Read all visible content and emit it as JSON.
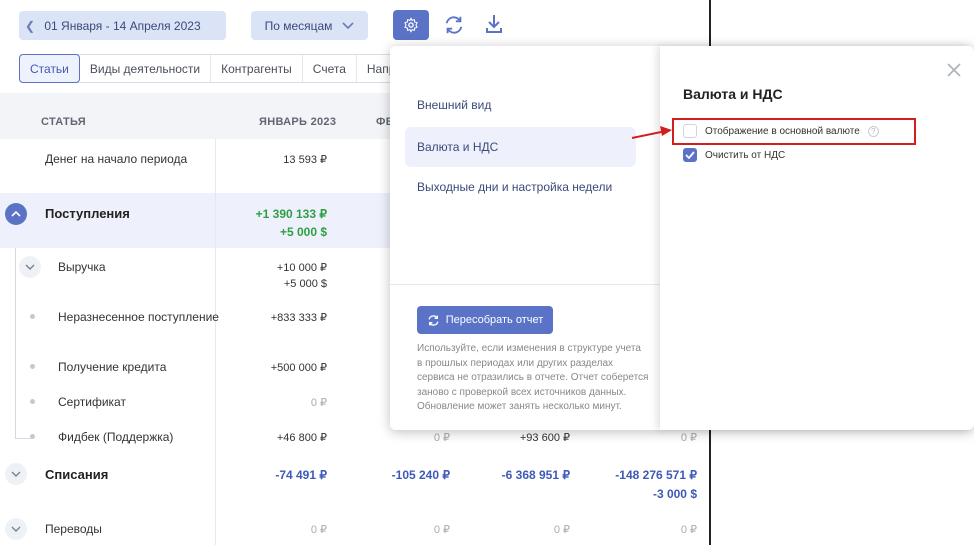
{
  "toolbar": {
    "date_range": "01 Января - 14 Апреля 2023",
    "period": "По месяцам"
  },
  "tabs": [
    "Статьи",
    "Виды деятельности",
    "Контрагенты",
    "Счета",
    "Напр"
  ],
  "table": {
    "headers": {
      "article": "СТАТЬЯ",
      "jan": "ЯНВАРЬ 2023",
      "feb": "ФЕ"
    },
    "rows": {
      "start": {
        "label": "Денег на начало периода",
        "jan": "13 593 ₽"
      },
      "income": {
        "label": "Поступления",
        "jan1": "+1 390 133 ₽",
        "jan2": "+5 000 $"
      },
      "revenue": {
        "label": "Выручка",
        "jan1": "+10 000 ₽",
        "jan2": "+5 000 $"
      },
      "unallocated": {
        "label": "Неразнесенное поступление",
        "jan": "+833 333 ₽"
      },
      "credit": {
        "label": "Получение кредита",
        "jan": "+500 000 ₽"
      },
      "cert": {
        "label": "Сертификат",
        "jan": "0 ₽"
      },
      "feedback": {
        "label": "Фидбек (Поддержка)",
        "jan": "+46 800 ₽",
        "feb": "0 ₽",
        "mar": "+93 600 ₽",
        "apr": "0 ₽"
      },
      "writeoff": {
        "label": "Списания",
        "jan": "-74 491 ₽",
        "feb": "-105 240 ₽",
        "mar": "-6 368 951 ₽",
        "apr1": "-148 276 571 ₽",
        "apr2": "-3 000 $"
      },
      "transfers": {
        "label": "Переводы",
        "jan": "0 ₽",
        "feb": "0 ₽",
        "mar": "0 ₽",
        "apr": "0 ₽"
      }
    }
  },
  "popup": {
    "menu": [
      "Внешний вид",
      "Валюта и НДС",
      "Выходные дни и настройка недели"
    ],
    "rebuild_label": "Пересобрать отчет",
    "hint": "Используйте, если изменения в структуре учета в прошлых периодах или других разделах сервиса не отразились в отчете. Отчет соберется заново с проверкой всех источников данных. Обновление может занять несколько минут.",
    "pane_title": "Валюта и НДС",
    "options": [
      {
        "label": "Отображение в основной валюте",
        "checked": false
      },
      {
        "label": "Очистить от НДС",
        "checked": true
      }
    ]
  },
  "colors": {
    "accent": "#5b73c7",
    "annotation": "#d11f1f",
    "positive": "#2f9e44"
  }
}
